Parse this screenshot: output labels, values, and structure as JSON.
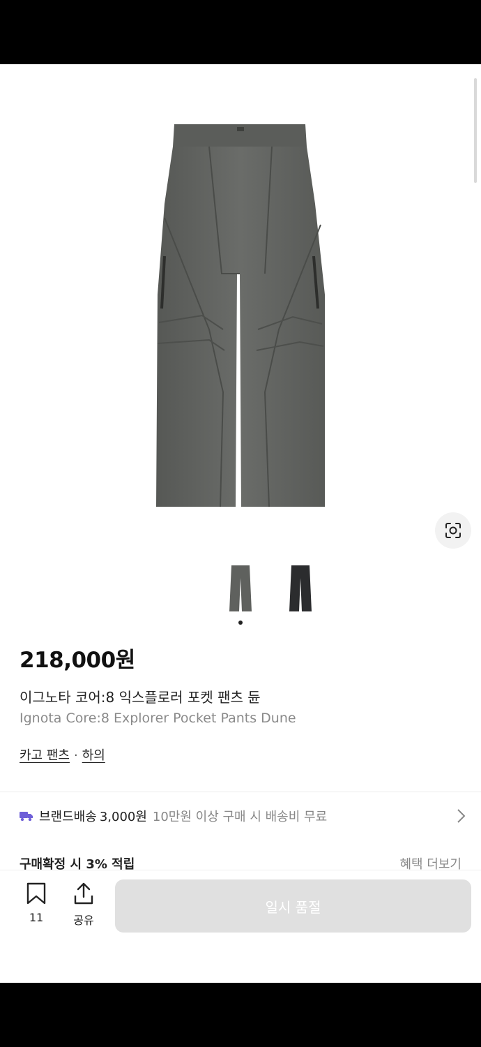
{
  "product": {
    "price": "218,000원",
    "name_ko": "이그노타 코어:8 익스플로러 포켓 팬츠 듄",
    "name_en": "Ignota Core:8 Explorer Pocket Pants Dune",
    "category": {
      "primary": "카고 팬츠",
      "separator": "·",
      "secondary": "하의"
    },
    "colors": {
      "image_1": "#5f615e",
      "image_2": "#2b2c2e"
    }
  },
  "gallery": {
    "thumbnail_count": 2,
    "active_index": 0,
    "lens_icon": "camera-lens-icon"
  },
  "shipping": {
    "icon": "truck-icon",
    "brand_label": "브랜드배송",
    "fee": "3,000원",
    "note": "10만원 이상 구매 시 배송비 무료",
    "accent": "#6e5fd8"
  },
  "reward": {
    "label": "구매확정 시 3% 적립",
    "more": "혜택 더보기"
  },
  "action_bar": {
    "bookmark_count": "11",
    "share_label": "공유",
    "cta_label": "일시 품절",
    "cta_color": "#e0e0e0"
  }
}
